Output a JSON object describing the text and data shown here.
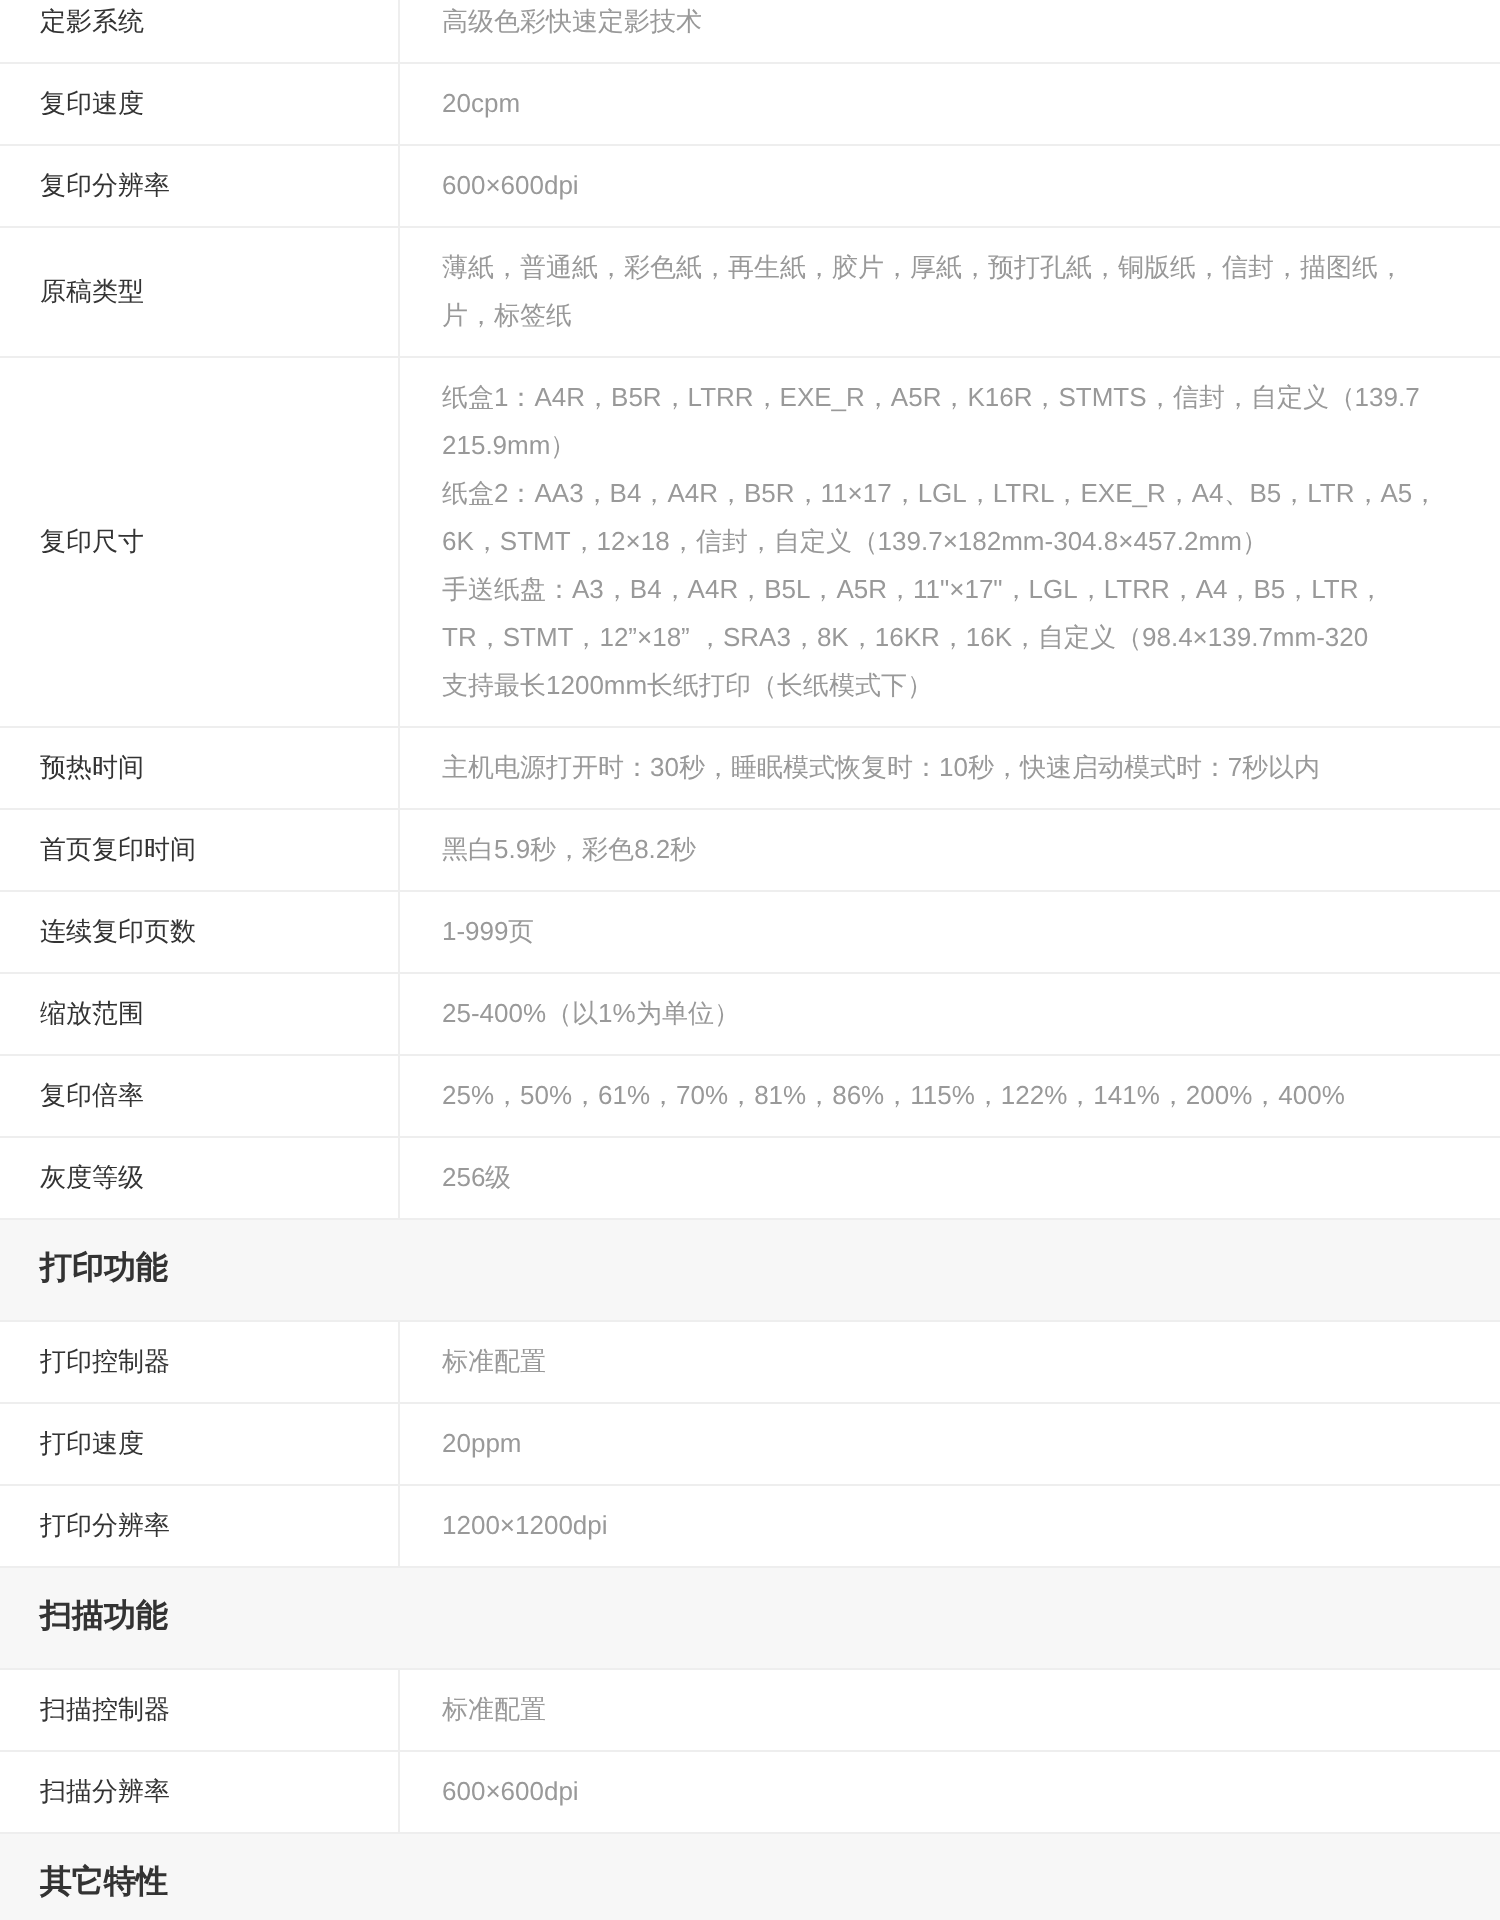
{
  "items": [
    {
      "kind": "row",
      "label": "定影系统",
      "lines": [
        "高级色彩快速定影技术"
      ]
    },
    {
      "kind": "row",
      "label": "复印速度",
      "lines": [
        "20cpm"
      ]
    },
    {
      "kind": "row",
      "label": "复印分辨率",
      "lines": [
        "600×600dpi"
      ]
    },
    {
      "kind": "row",
      "label": "原稿类型",
      "lines": [
        "薄紙，普通紙，彩色紙，再生紙，胶片，厚紙，预打孔紙，铜版纸，信封，描图纸，",
        "片，标签纸"
      ]
    },
    {
      "kind": "row",
      "label": "复印尺寸",
      "lines": [
        "纸盒1：A4R，B5R，LTRR，EXE_R，A5R，K16R，STMTS，信封，自定义（139.7",
        "215.9mm）",
        "纸盒2：AA3，B4，A4R，B5R，11×17，LGL，LTRL，EXE_R，A4、B5，LTR，A5，",
        "6K，STMT，12×18，信封，自定义（139.7×182mm-304.8×457.2mm）",
        "手送纸盘：A3，B4，A4R，B5L，A5R，11\"×17\"，LGL，LTRR，A4，B5，LTR，",
        "TR，STMT，12”×18” ，SRA3，8K，16KR，16K，自定义（98.4×139.7mm-320",
        "支持最长1200mm长纸打印（长纸模式下）"
      ]
    },
    {
      "kind": "row",
      "label": "预热时间",
      "lines": [
        "主机电源打开时：30秒，睡眠模式恢复时：10秒，快速启动模式时：7秒以内"
      ]
    },
    {
      "kind": "row",
      "label": "首页复印时间",
      "lines": [
        "黑白5.9秒，彩色8.2秒"
      ]
    },
    {
      "kind": "row",
      "label": "连续复印页数",
      "lines": [
        "1-999页"
      ]
    },
    {
      "kind": "row",
      "label": "缩放范围",
      "lines": [
        "25-400%（以1%为单位）"
      ]
    },
    {
      "kind": "row",
      "label": "复印倍率",
      "lines": [
        "25%，50%，61%，70%，81%，86%，115%，122%，141%，200%，400%"
      ]
    },
    {
      "kind": "row",
      "label": "灰度等级",
      "lines": [
        "256级"
      ]
    },
    {
      "kind": "heading",
      "title": "打印功能"
    },
    {
      "kind": "row",
      "label": "打印控制器",
      "lines": [
        "标准配置"
      ]
    },
    {
      "kind": "row",
      "label": "打印速度",
      "lines": [
        "20ppm"
      ]
    },
    {
      "kind": "row",
      "label": "打印分辨率",
      "lines": [
        "1200×1200dpi"
      ]
    },
    {
      "kind": "heading",
      "title": "扫描功能"
    },
    {
      "kind": "row",
      "label": "扫描控制器",
      "lines": [
        "标准配置"
      ]
    },
    {
      "kind": "row",
      "label": "扫描分辨率",
      "lines": [
        "600×600dpi"
      ]
    },
    {
      "kind": "heading",
      "title": "其它特性"
    }
  ]
}
